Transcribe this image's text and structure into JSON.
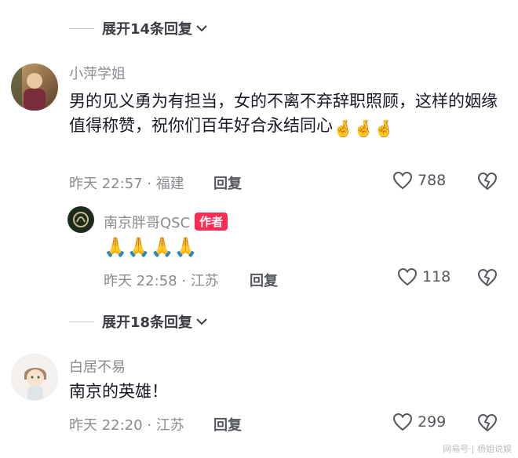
{
  "thread": {
    "expand_top": "展开14条回复",
    "expand_mid": "展开18条回复"
  },
  "comments": [
    {
      "username": "小萍学姐",
      "text": "男的见义勇为有担当，女的不离不弃辞职照顾，这样的姻缘值得称赞，祝你们百年好合永结同心",
      "emoji": "🤞🤞🤞",
      "time": "昨天 22:57",
      "location": "福建",
      "reply_label": "回复",
      "likes": "788"
    },
    {
      "username": "南京胖哥QSC",
      "badge": "作者",
      "emoji": "🙏🙏🙏🙏",
      "time": "昨天 22:58",
      "location": "江苏",
      "reply_label": "回复",
      "likes": "118"
    },
    {
      "username": "白居不易",
      "text": "南京的英雄！",
      "time": "昨天 22:20",
      "location": "江苏",
      "reply_label": "回复",
      "likes": "299"
    }
  ],
  "watermark": "网易号 | 杨姐说娱",
  "colors": {
    "accent": "#fe2c55",
    "muted": "#8a8b91"
  },
  "icons": [
    "chevron-down-icon",
    "heart-icon",
    "broken-heart-icon"
  ]
}
